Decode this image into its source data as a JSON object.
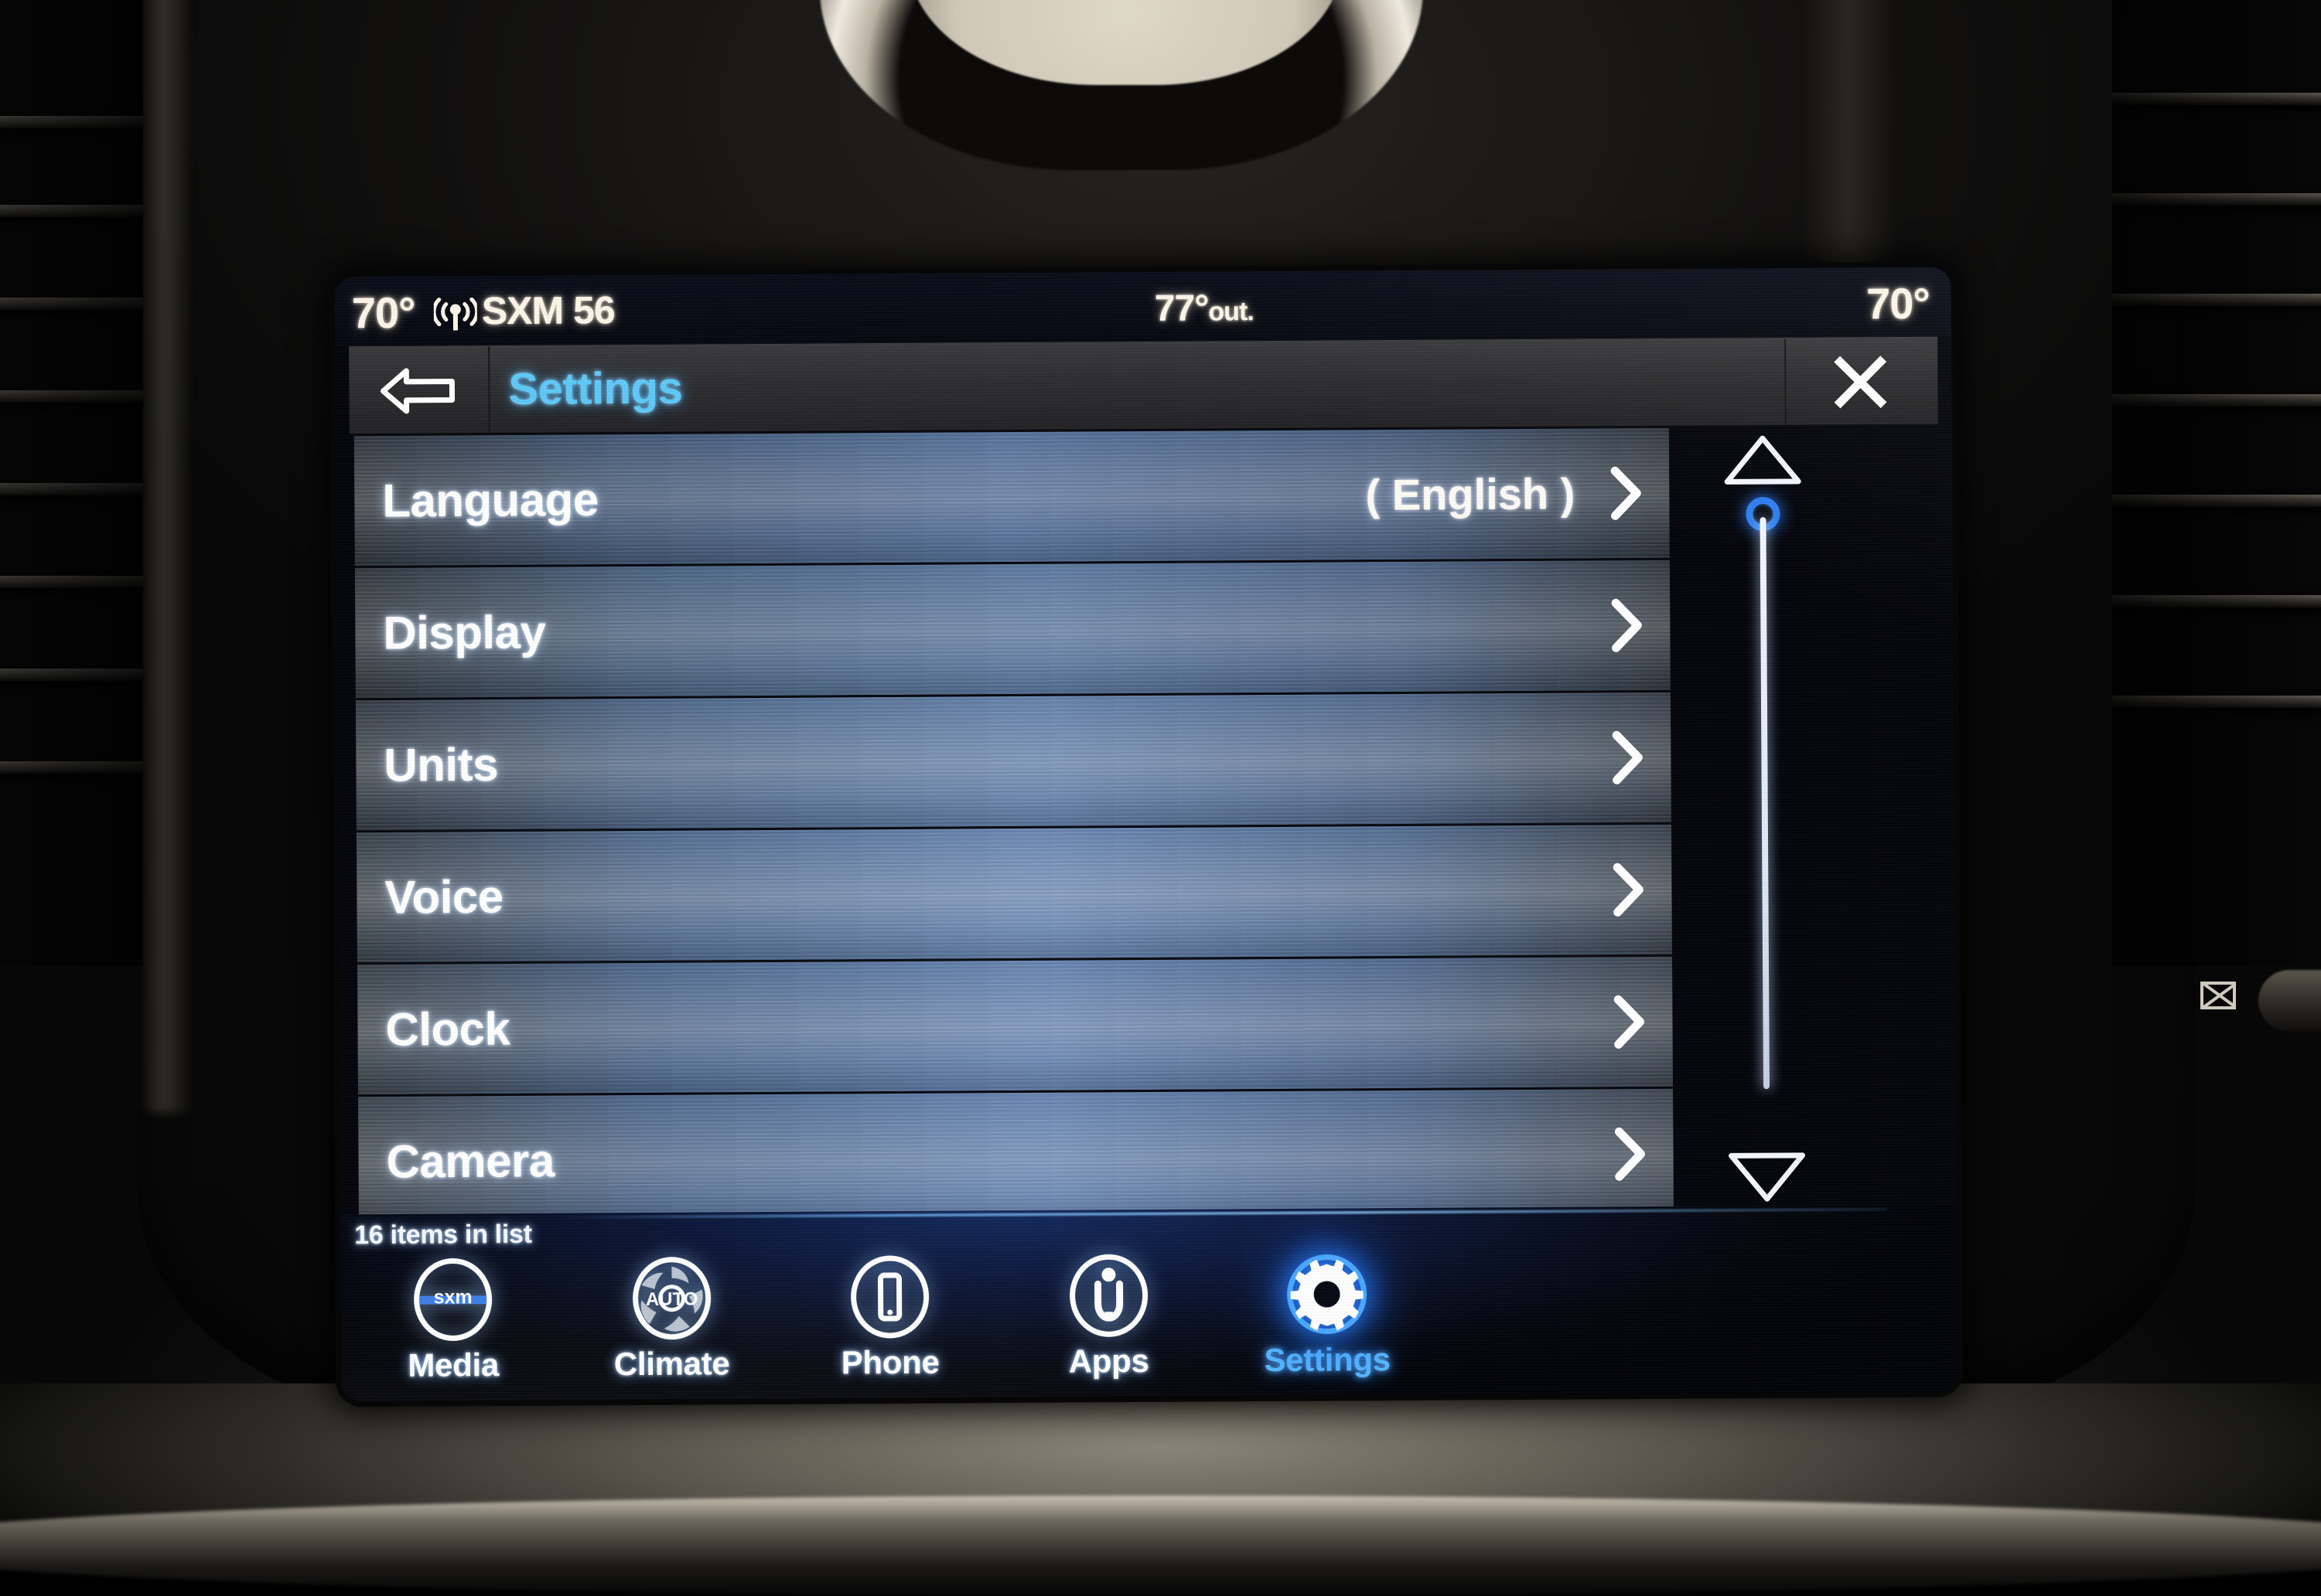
{
  "status_bar": {
    "temp_left": "70°",
    "radio_icon": "antenna-broadcast-icon",
    "radio_label": "SXM 56",
    "outside_temp": "77°",
    "outside_suffix": "out.",
    "temp_right": "70°"
  },
  "title_bar": {
    "back_icon": "back-arrow-icon",
    "title": "Settings",
    "close_icon": "close-x-icon",
    "title_color": "#5fc9f8"
  },
  "list": {
    "rows": [
      {
        "label": "Language",
        "value": "( English )",
        "chevron": "chevron-right-icon"
      },
      {
        "label": "Display",
        "value": "",
        "chevron": "chevron-right-icon"
      },
      {
        "label": "Units",
        "value": "",
        "chevron": "chevron-right-icon"
      },
      {
        "label": "Voice",
        "value": "",
        "chevron": "chevron-right-icon"
      },
      {
        "label": "Clock",
        "value": "",
        "chevron": "chevron-right-icon"
      },
      {
        "label": "Camera",
        "value": "",
        "chevron": "chevron-right-icon"
      }
    ],
    "items_count_text": "16 items in list"
  },
  "scrollbar": {
    "up_icon": "triangle-up-icon",
    "down_icon": "triangle-down-icon",
    "thumb_icon": "scroll-thumb-circle",
    "thumb_color": "#2f7ff0",
    "position_percent": 3
  },
  "bottom_nav": {
    "items": [
      {
        "label": "Media",
        "icon": "sxm-circle-icon",
        "active": false
      },
      {
        "label": "Climate",
        "icon": "auto-fan-icon",
        "active": false
      },
      {
        "label": "Phone",
        "icon": "phone-handset-icon",
        "active": false
      },
      {
        "label": "Apps",
        "icon": "uconnect-u-icon",
        "active": false
      },
      {
        "label": "Settings",
        "icon": "gear-icon",
        "active": true
      }
    ],
    "active_color": "#54b6ff"
  },
  "dashboard": {
    "vent_control_icon": "vent-close-x-icon"
  }
}
